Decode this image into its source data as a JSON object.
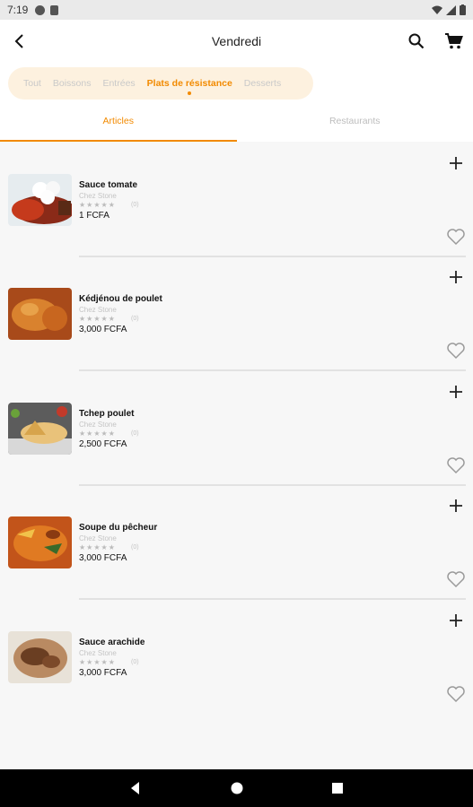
{
  "status": {
    "time": "7:19"
  },
  "header": {
    "title": "Vendredi"
  },
  "categories": [
    {
      "label": "Tout",
      "active": false
    },
    {
      "label": "Boissons",
      "active": false
    },
    {
      "label": "Entrées",
      "active": false
    },
    {
      "label": "Plats de résistance",
      "active": true
    },
    {
      "label": "Desserts",
      "active": false
    }
  ],
  "tabs": [
    {
      "label": "Articles",
      "active": true
    },
    {
      "label": "Restaurants",
      "active": false
    }
  ],
  "items": [
    {
      "name": "Sauce tomate",
      "store": "Chez Stone",
      "stars": "★★★★★",
      "rating_count": "(0)",
      "price": "1 FCFA"
    },
    {
      "name": "Kédjénou de poulet",
      "store": "Chez Stone",
      "stars": "★★★★★",
      "rating_count": "(0)",
      "price": "3,000 FCFA"
    },
    {
      "name": "Tchep poulet",
      "store": "Chez Stone",
      "stars": "★★★★★",
      "rating_count": "(0)",
      "price": "2,500 FCFA"
    },
    {
      "name": "Soupe du pêcheur",
      "store": "Chez Stone",
      "stars": "★★★★★",
      "rating_count": "(0)",
      "price": "3,000 FCFA"
    },
    {
      "name": "Sauce arachide",
      "store": "Chez Stone",
      "stars": "★★★★★",
      "rating_count": "(0)",
      "price": "3,000 FCFA"
    }
  ],
  "colors": {
    "accent": "#f28a00",
    "chip_bg": "#fdf1df"
  },
  "icons": [
    "back-arrow-icon",
    "search-icon",
    "cart-icon",
    "plus-icon",
    "heart-icon"
  ]
}
